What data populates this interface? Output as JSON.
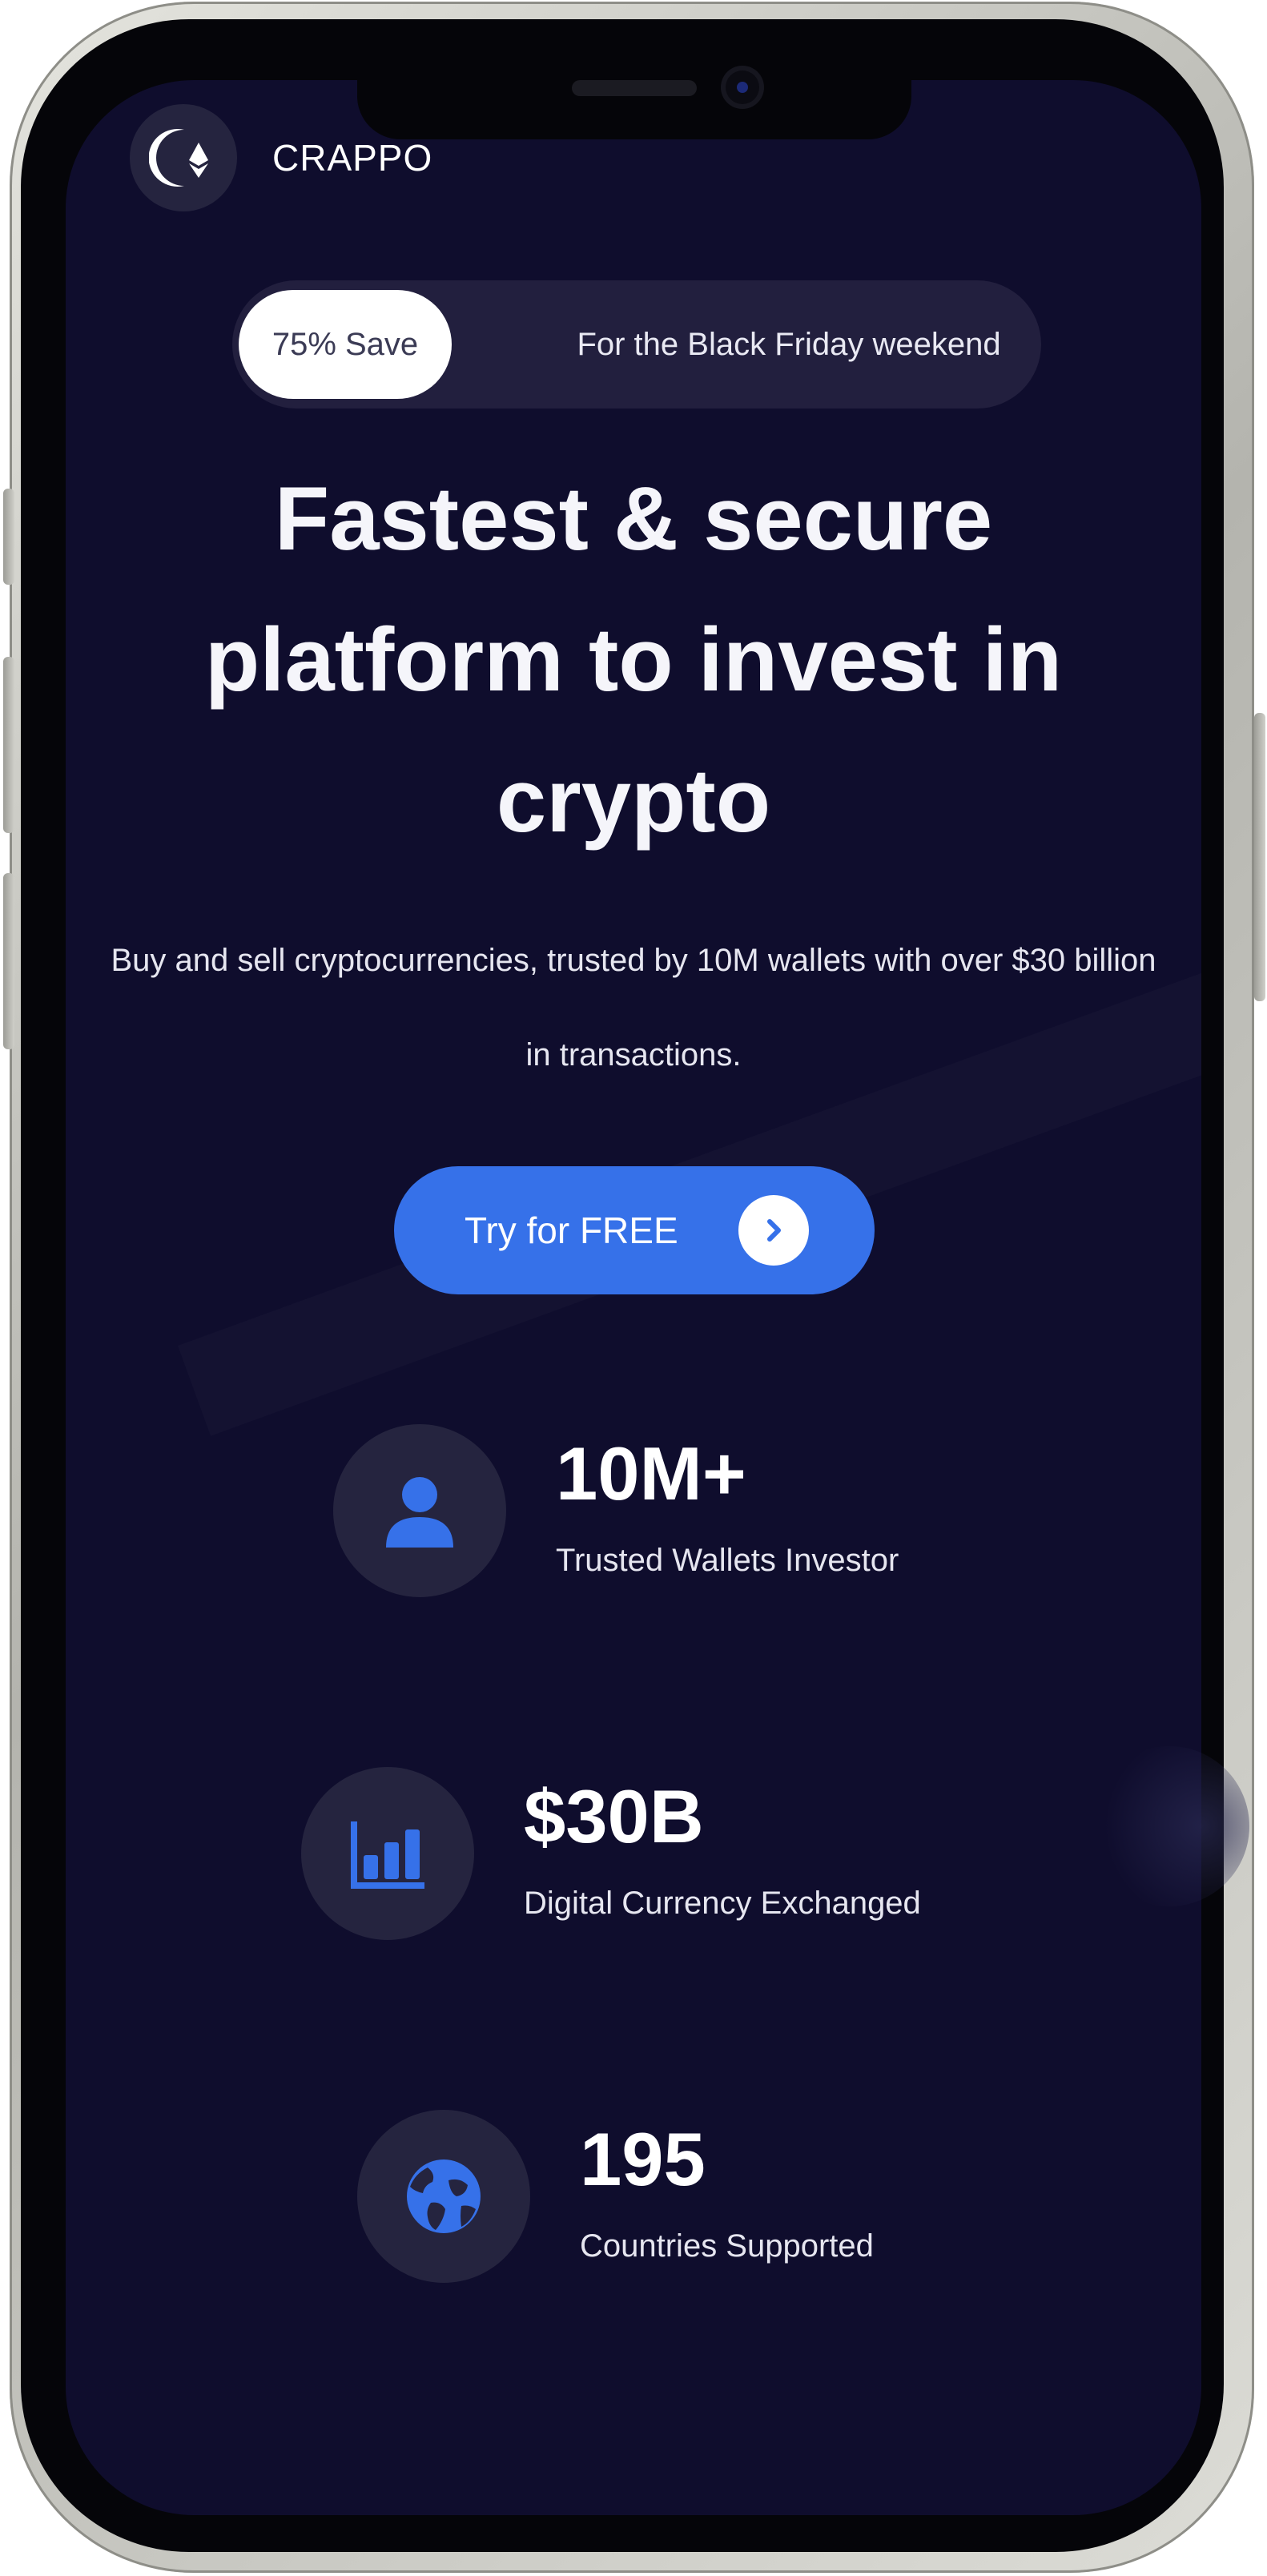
{
  "header": {
    "brand": "CRAPPO",
    "logo_icon": "moon-ethereum-logo"
  },
  "promo": {
    "badge": "75% Save",
    "text": "For the Black Friday weekend"
  },
  "hero": {
    "title": "Fastest & secure platform to invest in crypto",
    "subtitle": "Buy and sell cryptocurrencies, trusted by 10M wallets with over $30 billion in transactions."
  },
  "cta": {
    "label": "Try for FREE",
    "icon": "chevron-right-icon"
  },
  "stats": [
    {
      "value": "10M+",
      "label": "Trusted Wallets Investor",
      "icon": "user-icon"
    },
    {
      "value": "$30B",
      "label": "Digital Currency Exchanged",
      "icon": "bar-chart-icon"
    },
    {
      "value": "195",
      "label": "Countries Supported",
      "icon": "globe-icon"
    }
  ],
  "colors": {
    "background": "#0f0d2d",
    "accent": "#3671e9",
    "surface": "#25243f",
    "text": "#ffffff"
  }
}
